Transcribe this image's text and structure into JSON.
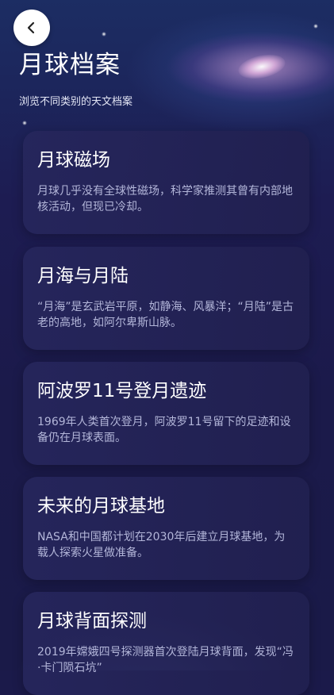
{
  "header": {
    "back_icon": "chevron-left-icon",
    "title": "月球档案",
    "subtitle": "浏览不同类别的天文档案"
  },
  "cards": [
    {
      "title": "月球磁场",
      "description": "月球几乎没有全球性磁场，科学家推测其曾有内部地核活动，但现已冷却。"
    },
    {
      "title": "月海与月陆",
      "description": "“月海”是玄武岩平原，如静海、风暴洋；“月陆”是古老的高地，如阿尔卑斯山脉。"
    },
    {
      "title": "阿波罗11号登月遗迹",
      "description": "1969年人类首次登月，阿波罗11号留下的足迹和设备仍在月球表面。"
    },
    {
      "title": "未来的月球基地",
      "description": "NASA和中国都计划在2030年后建立月球基地，为载人探索火星做准备。"
    },
    {
      "title": "月球背面探测",
      "description": "2019年嫦娥四号探测器首次登陆月球背面，发现“冯·卡门陨石坑”"
    }
  ]
}
